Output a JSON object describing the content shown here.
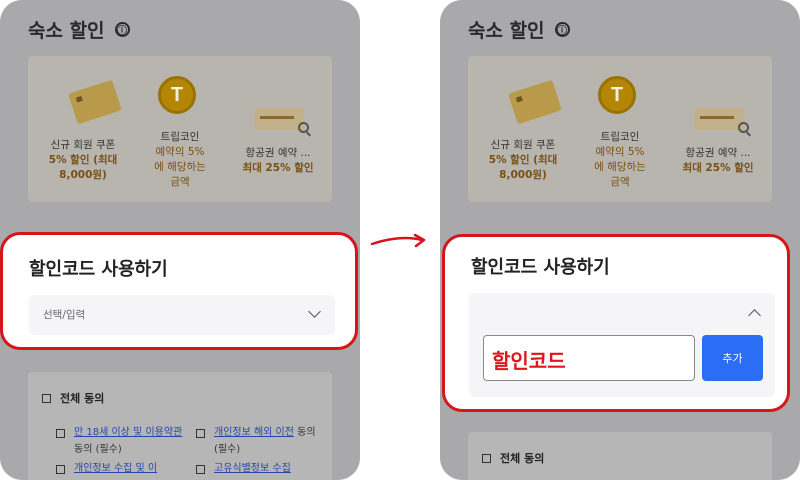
{
  "screen": {
    "title": "숙소 할인",
    "info_icon": "ⓘ",
    "promos": [
      {
        "label": "신규 회원 쿠폰",
        "line2": "5% 할인 (최대",
        "line3": "8,000원)"
      },
      {
        "label": "트립코인",
        "line2": "예약의 5%",
        "line3": "에 해당하는",
        "line4": "금액"
      },
      {
        "label": "항공권 예약 ...",
        "line2": "최대 25% 할인"
      }
    ],
    "coin_letter": "T"
  },
  "discount_code": {
    "title": "할인코드 사용하기",
    "select_placeholder": "선택/입력",
    "code_value": "할인코드",
    "add_button": "추가"
  },
  "agreement": {
    "all_label": "전체 동의",
    "terms": [
      {
        "link": "만 18세 이상 및 이용약관",
        "suffix": " 동의 (필수)"
      },
      {
        "link": "개인정보 해외 이전",
        "suffix": " 동의 (필수)"
      },
      {
        "link": "개인정보 수집 및 이",
        "suffix": ""
      },
      {
        "link": "고유식별정보 수집",
        "suffix": ""
      }
    ]
  },
  "colors": {
    "highlight_red": "#d6151b",
    "primary_blue": "#2b6ef5",
    "code_text_red": "#e1141c"
  }
}
